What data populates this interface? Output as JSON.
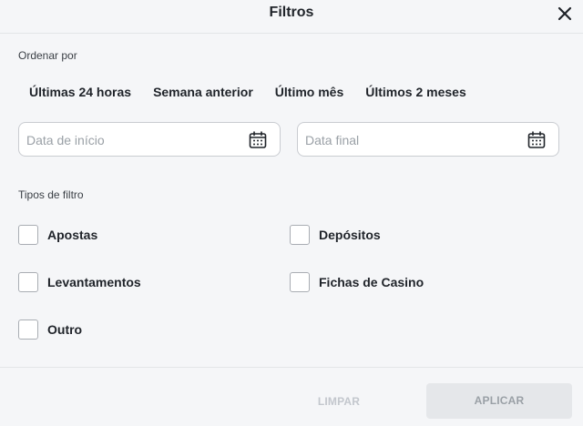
{
  "header": {
    "title": "Filtros"
  },
  "sort": {
    "label": "Ordenar por",
    "periods": [
      "Últimas 24 horas",
      "Semana anterior",
      "Último mês",
      "Últimos 2 meses"
    ]
  },
  "dates": {
    "start_placeholder": "Data de início",
    "start_value": "",
    "end_placeholder": "Data final",
    "end_value": ""
  },
  "filter_types": {
    "label": "Tipos de filtro",
    "options": [
      "Apostas",
      "Depósitos",
      "Levantamentos",
      "Fichas de Casino",
      "Outro"
    ]
  },
  "footer": {
    "clear_label": "LIMPAR",
    "apply_label": "APLICAR"
  }
}
